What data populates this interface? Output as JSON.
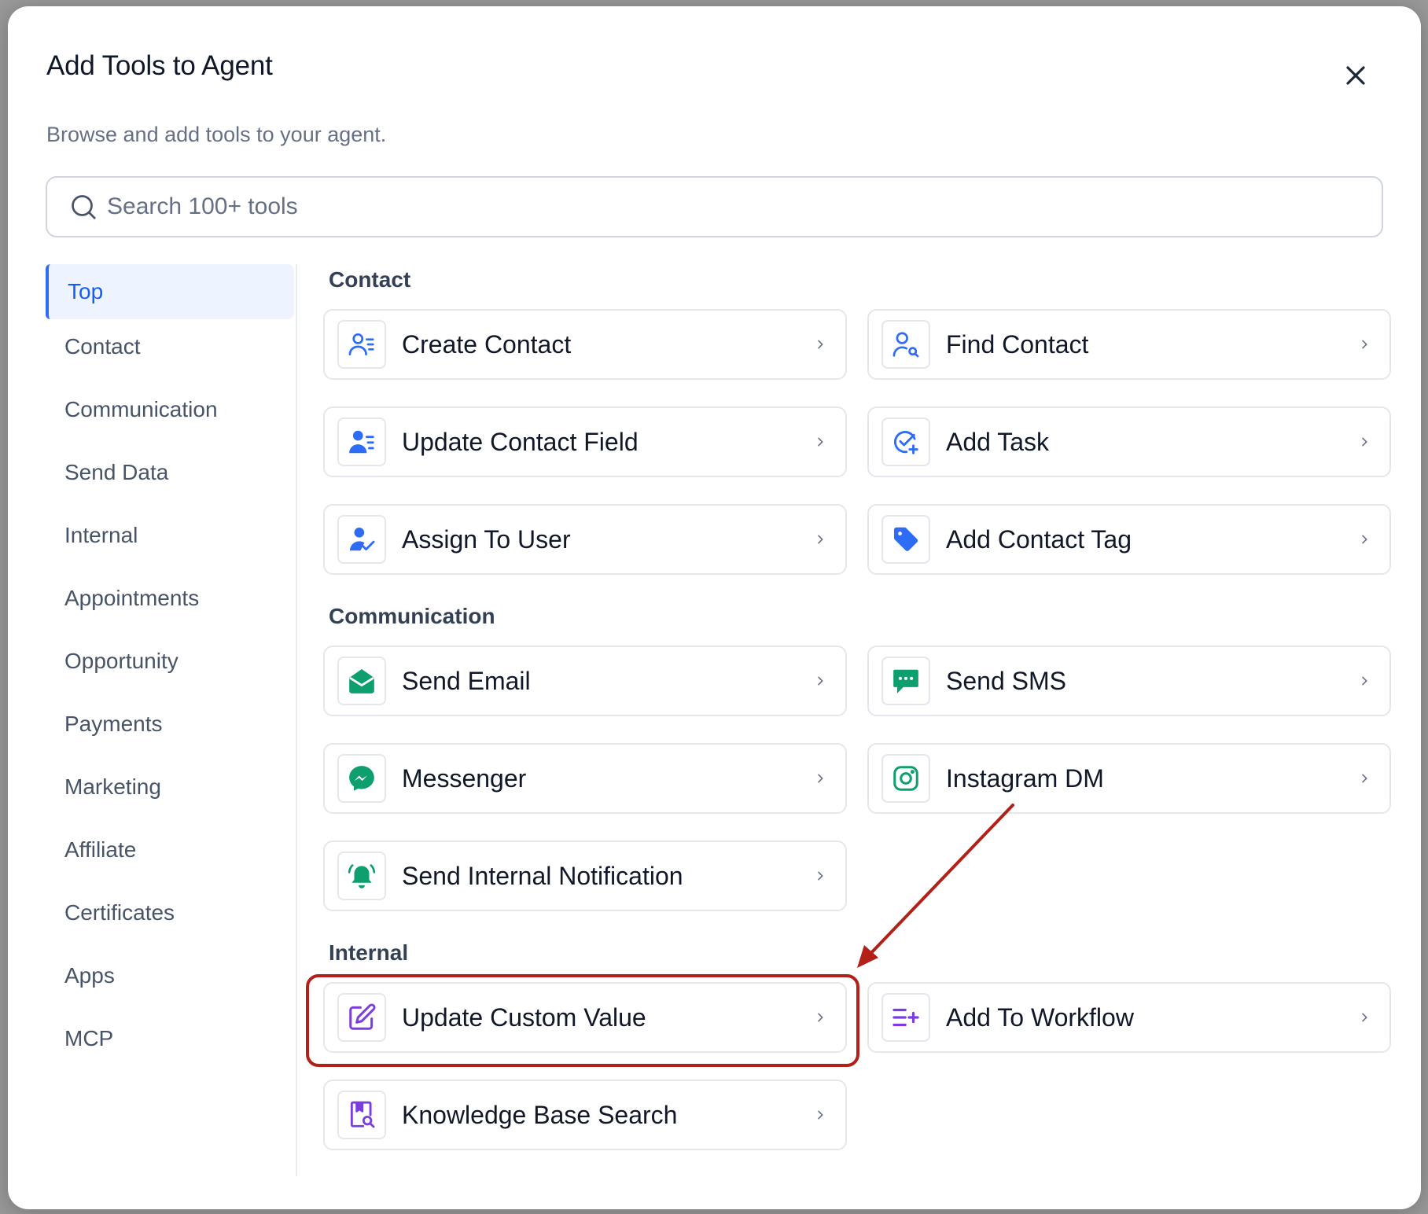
{
  "dialog": {
    "title": "Add Tools to Agent",
    "subtitle": "Browse and add tools to your agent.",
    "close_icon": "close-icon"
  },
  "search": {
    "placeholder": "Search 100+ tools",
    "value": ""
  },
  "sidebar": {
    "items": [
      {
        "label": "Top",
        "active": true
      },
      {
        "label": "Contact"
      },
      {
        "label": "Communication"
      },
      {
        "label": "Send Data"
      },
      {
        "label": "Internal"
      },
      {
        "label": "Appointments"
      },
      {
        "label": "Opportunity"
      },
      {
        "label": "Payments"
      },
      {
        "label": "Marketing"
      },
      {
        "label": "Affiliate"
      },
      {
        "label": "Certificates"
      },
      {
        "label": "Apps"
      },
      {
        "label": "MCP"
      }
    ]
  },
  "sections": [
    {
      "title": "Contact",
      "tools": [
        {
          "label": "Create Contact",
          "icon": "contact-list-icon",
          "color": "#2e6cf5"
        },
        {
          "label": "Find Contact",
          "icon": "contact-search-icon",
          "color": "#2e6cf5"
        },
        {
          "label": "Update Contact Field",
          "icon": "contact-edit-icon",
          "color": "#2e6cf5"
        },
        {
          "label": "Add Task",
          "icon": "task-add-icon",
          "color": "#2e6cf5"
        },
        {
          "label": "Assign To User",
          "icon": "user-assign-icon",
          "color": "#2e6cf5"
        },
        {
          "label": "Add Contact Tag",
          "icon": "tag-icon",
          "color": "#2e6cf5"
        }
      ]
    },
    {
      "title": "Communication",
      "tools": [
        {
          "label": "Send Email",
          "icon": "email-icon",
          "color": "#0e9f6e"
        },
        {
          "label": "Send SMS",
          "icon": "sms-icon",
          "color": "#0e9f6e"
        },
        {
          "label": "Messenger",
          "icon": "messenger-icon",
          "color": "#0e9f6e"
        },
        {
          "label": "Instagram DM",
          "icon": "instagram-icon",
          "color": "#0e9f6e"
        },
        {
          "label": "Send Internal Notification",
          "icon": "bell-icon",
          "color": "#0e9f6e"
        }
      ]
    },
    {
      "title": "Internal",
      "tools": [
        {
          "label": "Update Custom Value",
          "icon": "edit-icon",
          "color": "#7a3ee0",
          "highlighted": true
        },
        {
          "label": "Add To Workflow",
          "icon": "workflow-add-icon",
          "color": "#7a3ee0"
        },
        {
          "label": "Knowledge Base Search",
          "icon": "knowledge-search-icon",
          "color": "#7a3ee0"
        }
      ]
    }
  ],
  "colors": {
    "accent": "#155eef",
    "annotation": "#b22018"
  }
}
